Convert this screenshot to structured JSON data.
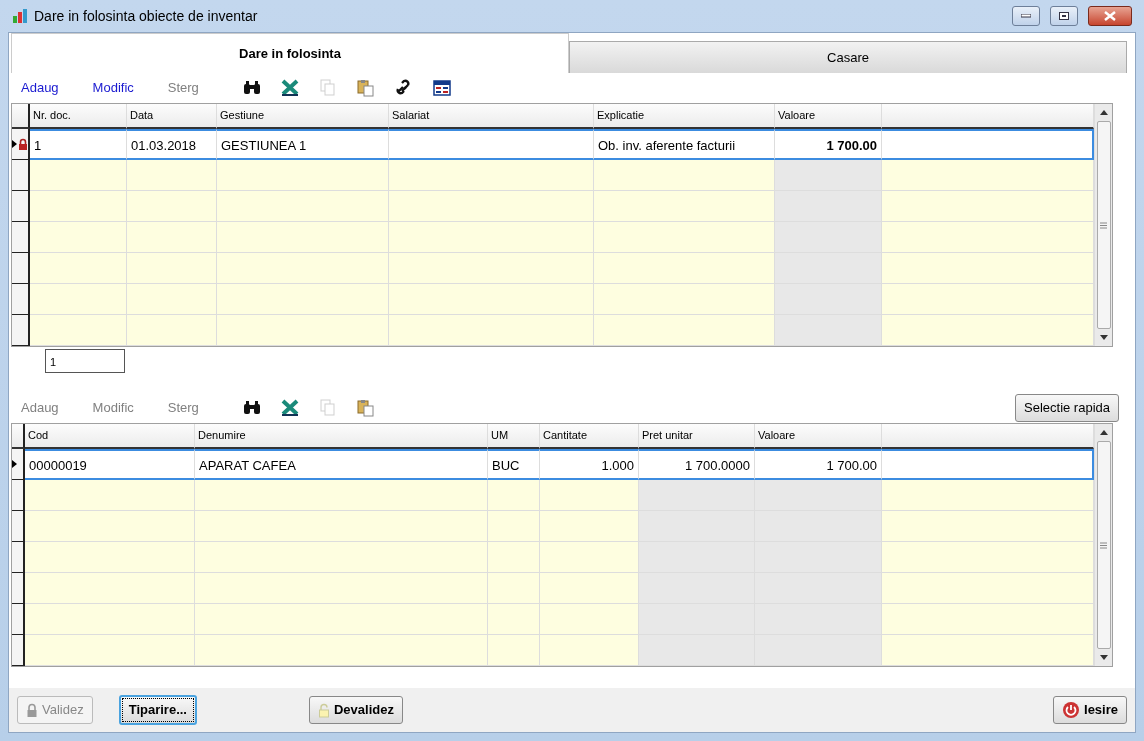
{
  "window": {
    "title": "Dare in folosinta obiecte de inventar"
  },
  "tabs": [
    {
      "label": "Dare in folosinta",
      "selected": true
    },
    {
      "label": "Casare",
      "selected": false
    }
  ],
  "documents": {
    "toolbar": [
      {
        "label": "Adaug",
        "disabled": false
      },
      {
        "label": "Modific",
        "disabled": false
      },
      {
        "label": "Sterg",
        "disabled": true
      }
    ],
    "tools": [
      {
        "kind": "find",
        "disabled": false
      },
      {
        "kind": "excel",
        "disabled": false
      },
      {
        "kind": "copy",
        "disabled": true
      },
      {
        "kind": "paste",
        "disabled": false
      },
      {
        "kind": "link",
        "disabled": false
      },
      {
        "kind": "grid",
        "disabled": false
      }
    ],
    "columns": [
      "Nr. doc.",
      "Data",
      "Gestiune",
      "Salariat",
      "Explicatie",
      "Valoare"
    ],
    "rows": [
      {
        "cells": [
          "1",
          "01.03.2018",
          "GESTIUNEA 1",
          "",
          "Ob. inv. aferente facturii",
          "1 700.00"
        ],
        "current": true,
        "locked": true
      }
    ],
    "counter": "1"
  },
  "lines": {
    "toolbar": [
      {
        "label": "Adaug",
        "disabled": true
      },
      {
        "label": "Modific",
        "disabled": true
      },
      {
        "label": "Sterg",
        "disabled": true
      }
    ],
    "tools": [
      {
        "kind": "find",
        "disabled": false
      },
      {
        "kind": "excel",
        "disabled": false
      },
      {
        "kind": "copy",
        "disabled": true
      },
      {
        "kind": "paste",
        "disabled": false
      }
    ],
    "action_button": "Selectie rapida",
    "columns": [
      "Cod",
      "Denumire",
      "UM",
      "Cantitate",
      "Pret unitar",
      "Valoare"
    ],
    "rows": [
      {
        "cells": [
          "00000019",
          "APARAT CAFEA",
          "BUC",
          "1.000",
          "1 700.0000",
          "1 700.00"
        ],
        "current": true,
        "locked": false
      }
    ]
  },
  "footer": [
    {
      "kind": "validate",
      "label": "Validez",
      "disabled": true,
      "focused": false
    },
    {
      "kind": "print",
      "label": "Tiparire...",
      "disabled": false,
      "focused": true
    },
    {
      "kind": "unvalidate",
      "label": "Devalidez",
      "disabled": false,
      "focused": false
    },
    {
      "kind": "exit",
      "label": "Iesire",
      "disabled": false,
      "focused": false
    }
  ]
}
